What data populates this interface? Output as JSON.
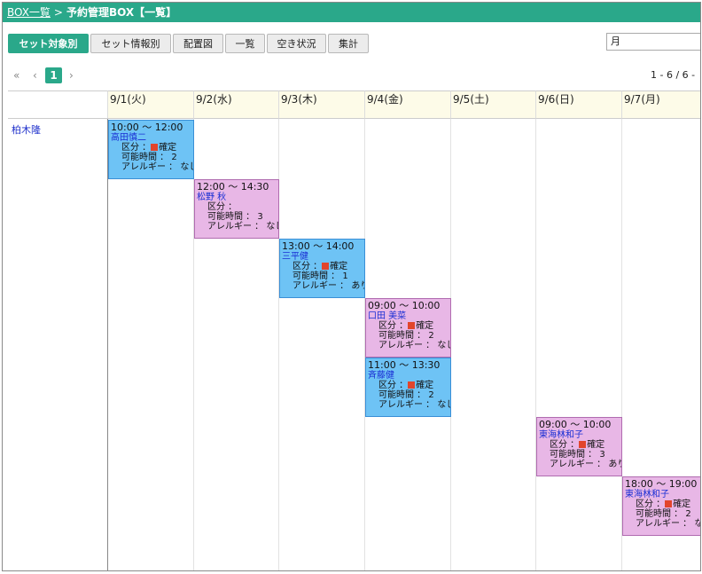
{
  "breadcrumb": {
    "parent": "BOX一覧",
    "separator": ">",
    "current": "予約管理BOX【一覧】"
  },
  "tabs": [
    {
      "label": "セット対象別",
      "active": true
    },
    {
      "label": "セット情報別",
      "active": false
    },
    {
      "label": "配置図",
      "active": false
    },
    {
      "label": "一覧",
      "active": false
    },
    {
      "label": "空き状況",
      "active": false
    },
    {
      "label": "集計",
      "active": false
    }
  ],
  "period_select": {
    "value": "月"
  },
  "pager": {
    "first": "«",
    "prev": "‹",
    "page": "1",
    "next": "›",
    "info": "1 - 6 / 6 -"
  },
  "calendar": {
    "days": [
      "9/1(火)",
      "9/2(水)",
      "9/3(木)",
      "9/4(金)",
      "9/5(土)",
      "9/6(日)",
      "9/7(月)"
    ],
    "person": "柏木隆",
    "labels": {
      "kubun": "区分 ：",
      "kanou": "可能時間 ：",
      "allergy": "アレルギー ："
    },
    "events": [
      {
        "time": "10:00 ～ 12:00",
        "name": "高田慎二",
        "kubun": "確定",
        "kanou": "2",
        "allergy": "なし"
      },
      {
        "time": "12:00 ～ 14:30",
        "name": "松野 秋",
        "kubun": "",
        "kanou": "3",
        "allergy": "なし"
      },
      {
        "time": "13:00 ～ 14:00",
        "name": "三平健",
        "kubun": "確定",
        "kanou": "1",
        "allergy": "あり"
      },
      {
        "time": "09:00 ～ 10:00",
        "name": "口田 美菜",
        "kubun": "確定",
        "kanou": "2",
        "allergy": "なし"
      },
      {
        "time": "11:00 ～ 13:30",
        "name": "斉藤健",
        "kubun": "確定",
        "kanou": "2",
        "allergy": "なし"
      },
      {
        "time": "09:00 ～ 10:00",
        "name": "東海林和子",
        "kubun": "確定",
        "kanou": "3",
        "allergy": "あり"
      },
      {
        "time": "18:00 ～ 19:00",
        "name": "東海林和子",
        "kubun": "確定",
        "kanou": "2",
        "allergy": "なし"
      }
    ]
  },
  "colors": {
    "accent": "#2aa88a",
    "event_blue": "#6ec3f5",
    "event_pink": "#e8b7e6",
    "status_red": "#e2452c"
  }
}
